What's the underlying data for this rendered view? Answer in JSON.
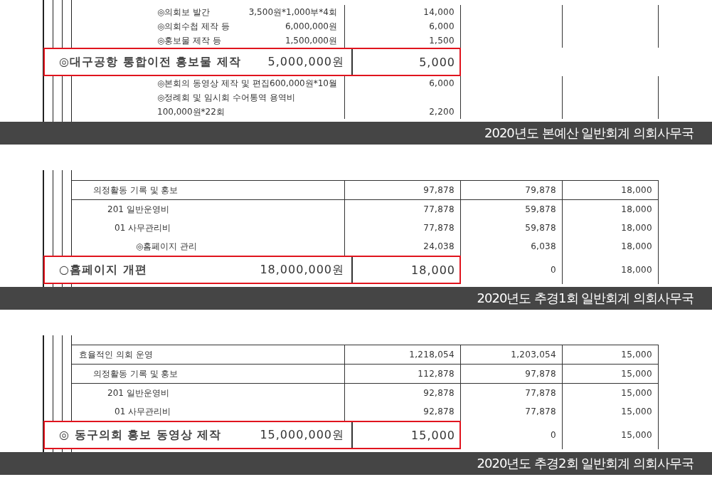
{
  "panels": [
    {
      "caption": "2020년도 본예산 일반회계 의회사무국",
      "rows": [
        {
          "kind": "item",
          "label": "◎의회보 발간",
          "detail": "3,500원*1,000부*4회",
          "cells": [
            "14,000"
          ]
        },
        {
          "kind": "item",
          "label": "◎의회수첩 제작 등",
          "detail": "6,000,000원",
          "cells": [
            "6,000"
          ]
        },
        {
          "kind": "item",
          "label": "◎홍보물 제작 등",
          "detail": "1,500,000원",
          "cells": [
            "1,500"
          ]
        },
        {
          "kind": "highlight",
          "label": "◎대구공항 통합이전 홍보물 제작",
          "detail": "5,000,000원",
          "cells": [
            "5,000"
          ]
        },
        {
          "kind": "item",
          "label": "◎본회의 동영상 제작 및 편집",
          "detail": "600,000원*10월",
          "cells": [
            "6,000"
          ]
        },
        {
          "kind": "item",
          "label": "◎정례회 및 임시회 수어통역 용역비"
        },
        {
          "kind": "item",
          "detail": "100,000원*22회",
          "cells": [
            "2,200"
          ]
        }
      ]
    },
    {
      "caption": "2020년도 추경1회 일반회계 의회사무국",
      "rows": [
        {
          "kind": "subgroup",
          "label": "의정활동 기록 및 홍보",
          "cells": [
            "97,878",
            "79,878",
            "18,000"
          ]
        },
        {
          "kind": "account",
          "label": "201 일반운영비",
          "cells": [
            "77,878",
            "59,878",
            "18,000"
          ]
        },
        {
          "kind": "item",
          "label": "01 사무관리비",
          "cells": [
            "77,878",
            "59,878",
            "18,000"
          ]
        },
        {
          "kind": "subitem",
          "label": "◎홈페이지 관리",
          "cells": [
            "24,038",
            "6,038",
            "18,000"
          ]
        },
        {
          "kind": "highlight",
          "label": "○홈페이지 개편",
          "detail": "18,000,000원",
          "cells": [
            "18,000",
            "0",
            "18,000"
          ]
        }
      ]
    },
    {
      "caption": "2020년도 추경2회 일반회계 의회사무국",
      "rows": [
        {
          "kind": "group",
          "label": "효율적인 의회 운영",
          "cells": [
            "1,218,054",
            "1,203,054",
            "15,000"
          ]
        },
        {
          "kind": "subgroup",
          "label": "의정활동 기록 및 홍보",
          "cells": [
            "112,878",
            "97,878",
            "15,000"
          ]
        },
        {
          "kind": "account",
          "label": "201 일반운영비",
          "cells": [
            "92,878",
            "77,878",
            "15,000"
          ]
        },
        {
          "kind": "item",
          "label": "01 사무관리비",
          "cells": [
            "92,878",
            "77,878",
            "15,000"
          ]
        },
        {
          "kind": "highlight",
          "label": "◎ 동구의회 홍보 동영상 제작",
          "detail": "15,000,000원",
          "cells": [
            "15,000",
            "0",
            "15,000"
          ]
        }
      ]
    }
  ]
}
